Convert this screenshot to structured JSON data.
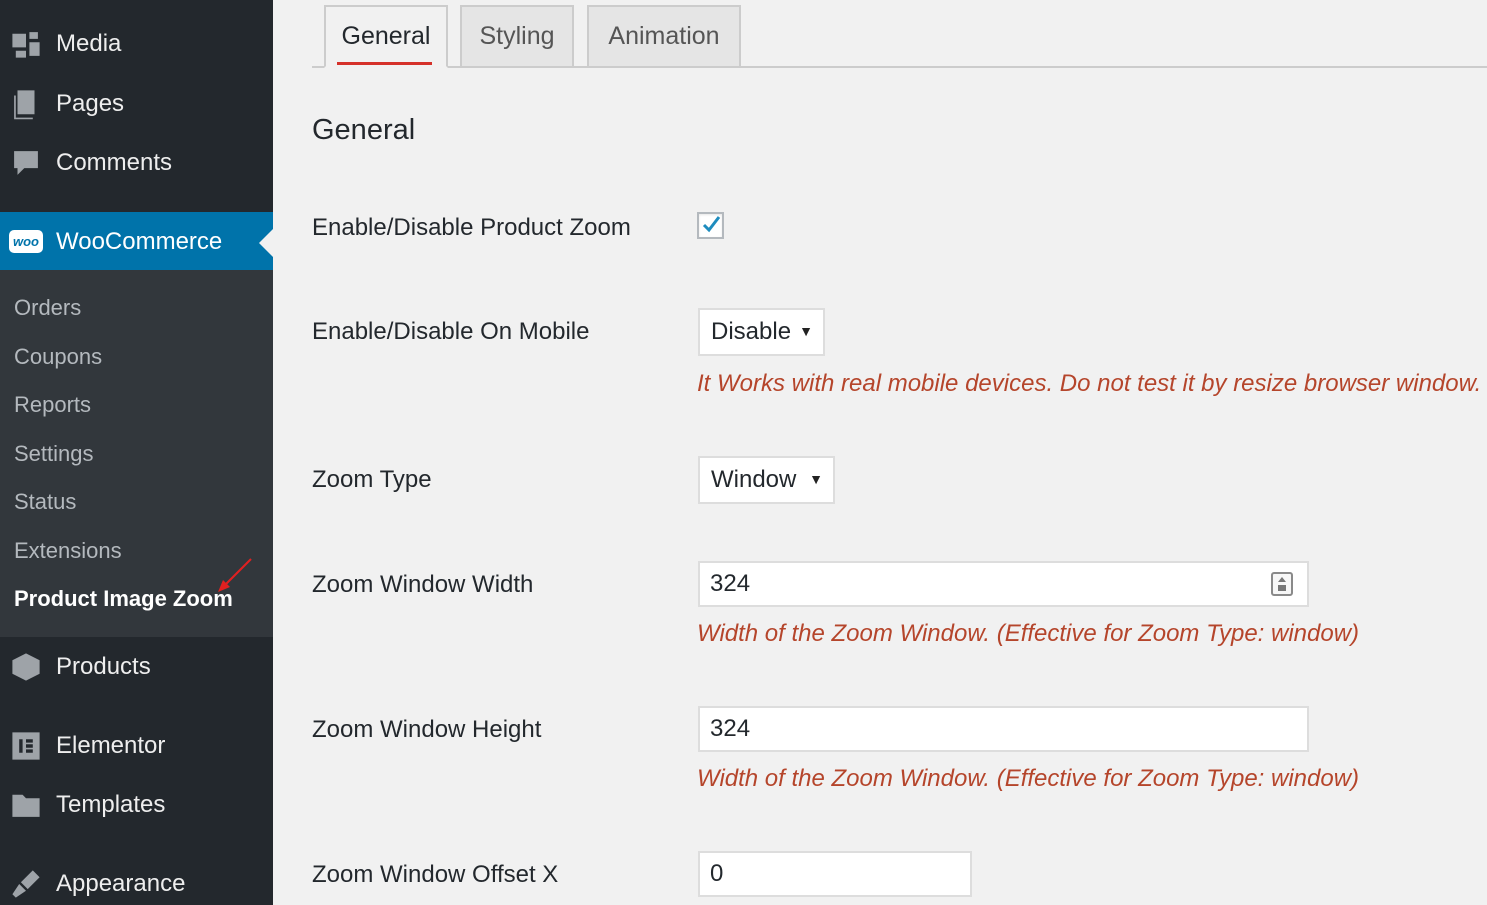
{
  "sidebar": {
    "items": [
      {
        "label": "Media",
        "icon": "media-icon"
      },
      {
        "label": "Pages",
        "icon": "pages-icon"
      },
      {
        "label": "Comments",
        "icon": "comments-icon"
      },
      {
        "label": "WooCommerce",
        "icon": "woocommerce-icon",
        "icon_text": "woo"
      },
      {
        "label": "Products",
        "icon": "products-icon"
      },
      {
        "label": "Elementor",
        "icon": "elementor-icon"
      },
      {
        "label": "Templates",
        "icon": "templates-icon"
      },
      {
        "label": "Appearance",
        "icon": "appearance-icon"
      }
    ],
    "submenu": [
      "Orders",
      "Coupons",
      "Reports",
      "Settings",
      "Status",
      "Extensions",
      "Product Image Zoom"
    ]
  },
  "tabs": [
    {
      "label": "General",
      "active": true
    },
    {
      "label": "Styling",
      "active": false
    },
    {
      "label": "Animation",
      "active": false
    }
  ],
  "section_title": "General",
  "fields": {
    "product_zoom": {
      "label": "Enable/Disable Product Zoom",
      "checked": true
    },
    "on_mobile": {
      "label": "Enable/Disable On Mobile",
      "value": "Disable",
      "description": "It Works with real mobile devices. Do not test it by resize browser window."
    },
    "zoom_type": {
      "label": "Zoom Type",
      "value": "Window"
    },
    "window_width": {
      "label": "Zoom Window Width",
      "value": "324",
      "description": "Width of the Zoom Window. (Effective for Zoom Type: window)"
    },
    "window_height": {
      "label": "Zoom Window Height",
      "value": "324",
      "description": "Width of the Zoom Window. (Effective for Zoom Type: window)"
    },
    "offset_x": {
      "label": "Zoom Window Offset X",
      "value": "0"
    }
  },
  "colors": {
    "sidebar_bg": "#23282d",
    "submenu_bg": "#32373c",
    "accent": "#0073aa",
    "description": "#b5452b",
    "tab_underline": "#d5312a"
  }
}
